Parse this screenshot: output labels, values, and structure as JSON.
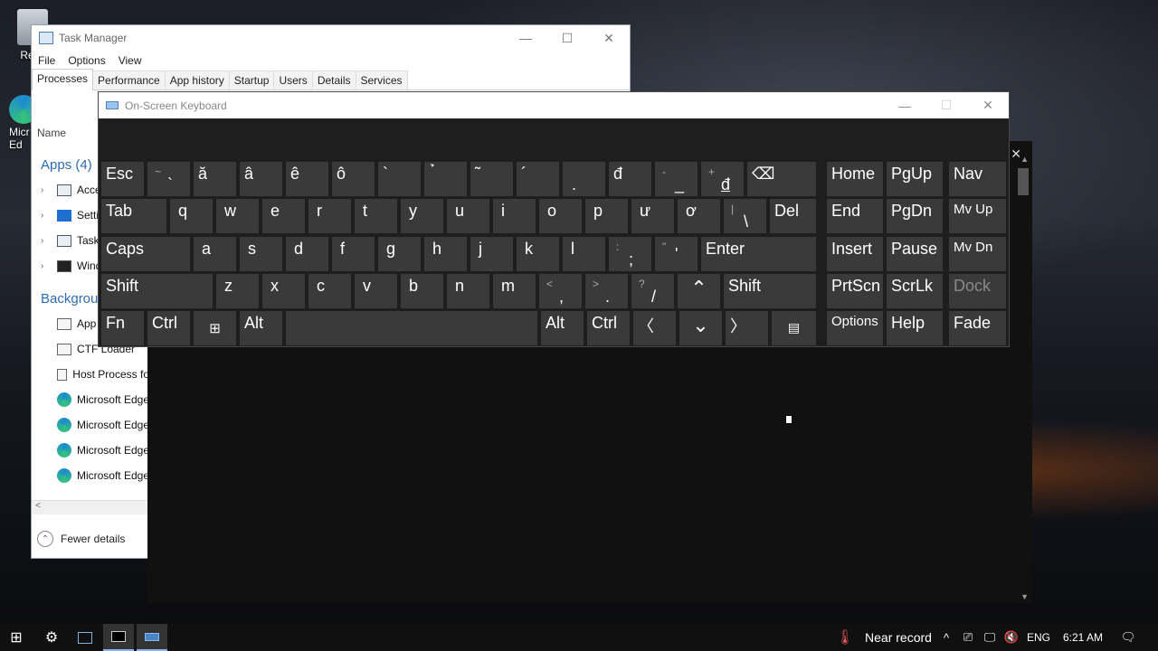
{
  "desktop": {
    "icons": [
      {
        "label": "Recy",
        "icon": "recycle-bin-icon"
      },
      {
        "label": "Micr\nEd",
        "icon": "edge-icon"
      }
    ]
  },
  "task_manager": {
    "title": "Task Manager",
    "menu": [
      "File",
      "Options",
      "View"
    ],
    "tabs": [
      "Processes",
      "Performance",
      "App history",
      "Startup",
      "Users",
      "Details",
      "Services"
    ],
    "active_tab": "Processes",
    "column_name": "Name",
    "apps_group": "Apps (4)",
    "apps": [
      "Acce",
      "Setti",
      "Task",
      "Wind"
    ],
    "background_group": "Backgrou",
    "background": [
      "App",
      "CTF Loader",
      "Host Process fo",
      "Microsoft Edge",
      "Microsoft Edge",
      "Microsoft Edge",
      "Microsoft Edge"
    ],
    "footer": "Fewer details",
    "scroll_left": "<"
  },
  "osk": {
    "title": "On-Screen Keyboard",
    "keys": {
      "esc": "Esc",
      "tilde_sub": "~",
      "tilde": "`",
      "a_breve": "ă",
      "a_circ": "â",
      "e_circ": "ê",
      "o_circ": "ô",
      "grave": "`",
      "hook": "̉",
      "tilde_acc": "˜",
      "acute": "´",
      "dot_below": ".",
      "d_bar": "đ",
      "minus_sub": "_",
      "minus": "-",
      "plus_sub": "+",
      "equals": "đ",
      "backspace": "⌫",
      "home": "Home",
      "pgup": "PgUp",
      "nav": "Nav",
      "tab": "Tab",
      "q": "q",
      "w": "w",
      "e": "e",
      "r": "r",
      "t": "t",
      "y": "y",
      "u": "u",
      "i": "i",
      "o": "o",
      "p": "p",
      "u_horn": "ư",
      "o_horn": "ơ",
      "pipe": "|",
      "backslash": "\\",
      "del": "Del",
      "end": "End",
      "pgdn": "PgDn",
      "mvup": "Mv Up",
      "caps": "Caps",
      "a": "a",
      "s": "s",
      "d": "d",
      "f": "f",
      "g": "g",
      "h": "h",
      "j": "j",
      "k": "k",
      "l": "l",
      "colon": ":",
      "semicolon": ";",
      "quote_sub": "\"",
      "quote": "'",
      "enter": "Enter",
      "insert": "Insert",
      "pause": "Pause",
      "mvdn": "Mv Dn",
      "shift": "Shift",
      "z": "z",
      "x": "x",
      "c": "c",
      "v": "v",
      "b": "b",
      "n": "n",
      "m": "m",
      "lt": "<",
      "comma": ",",
      "gt": ">",
      "period": ".",
      "qmark": "?",
      "slash": "/",
      "up": "⌃",
      "shift_r": "Shift",
      "prtscn": "PrtScn",
      "scrlk": "ScrLk",
      "dock": "Dock",
      "fn": "Fn",
      "ctrl": "Ctrl",
      "win": "⊞",
      "alt": "Alt",
      "space": "",
      "alt_r": "Alt",
      "ctrl_r": "Ctrl",
      "left": "〈",
      "down": "⌄",
      "right": "〉",
      "menu": "▤",
      "options": "Options",
      "help": "Help",
      "fade": "Fade"
    }
  },
  "taskbar": {
    "weather": "Near record",
    "lang": "ENG",
    "time": "6:21 AM",
    "tray_up": "^"
  }
}
